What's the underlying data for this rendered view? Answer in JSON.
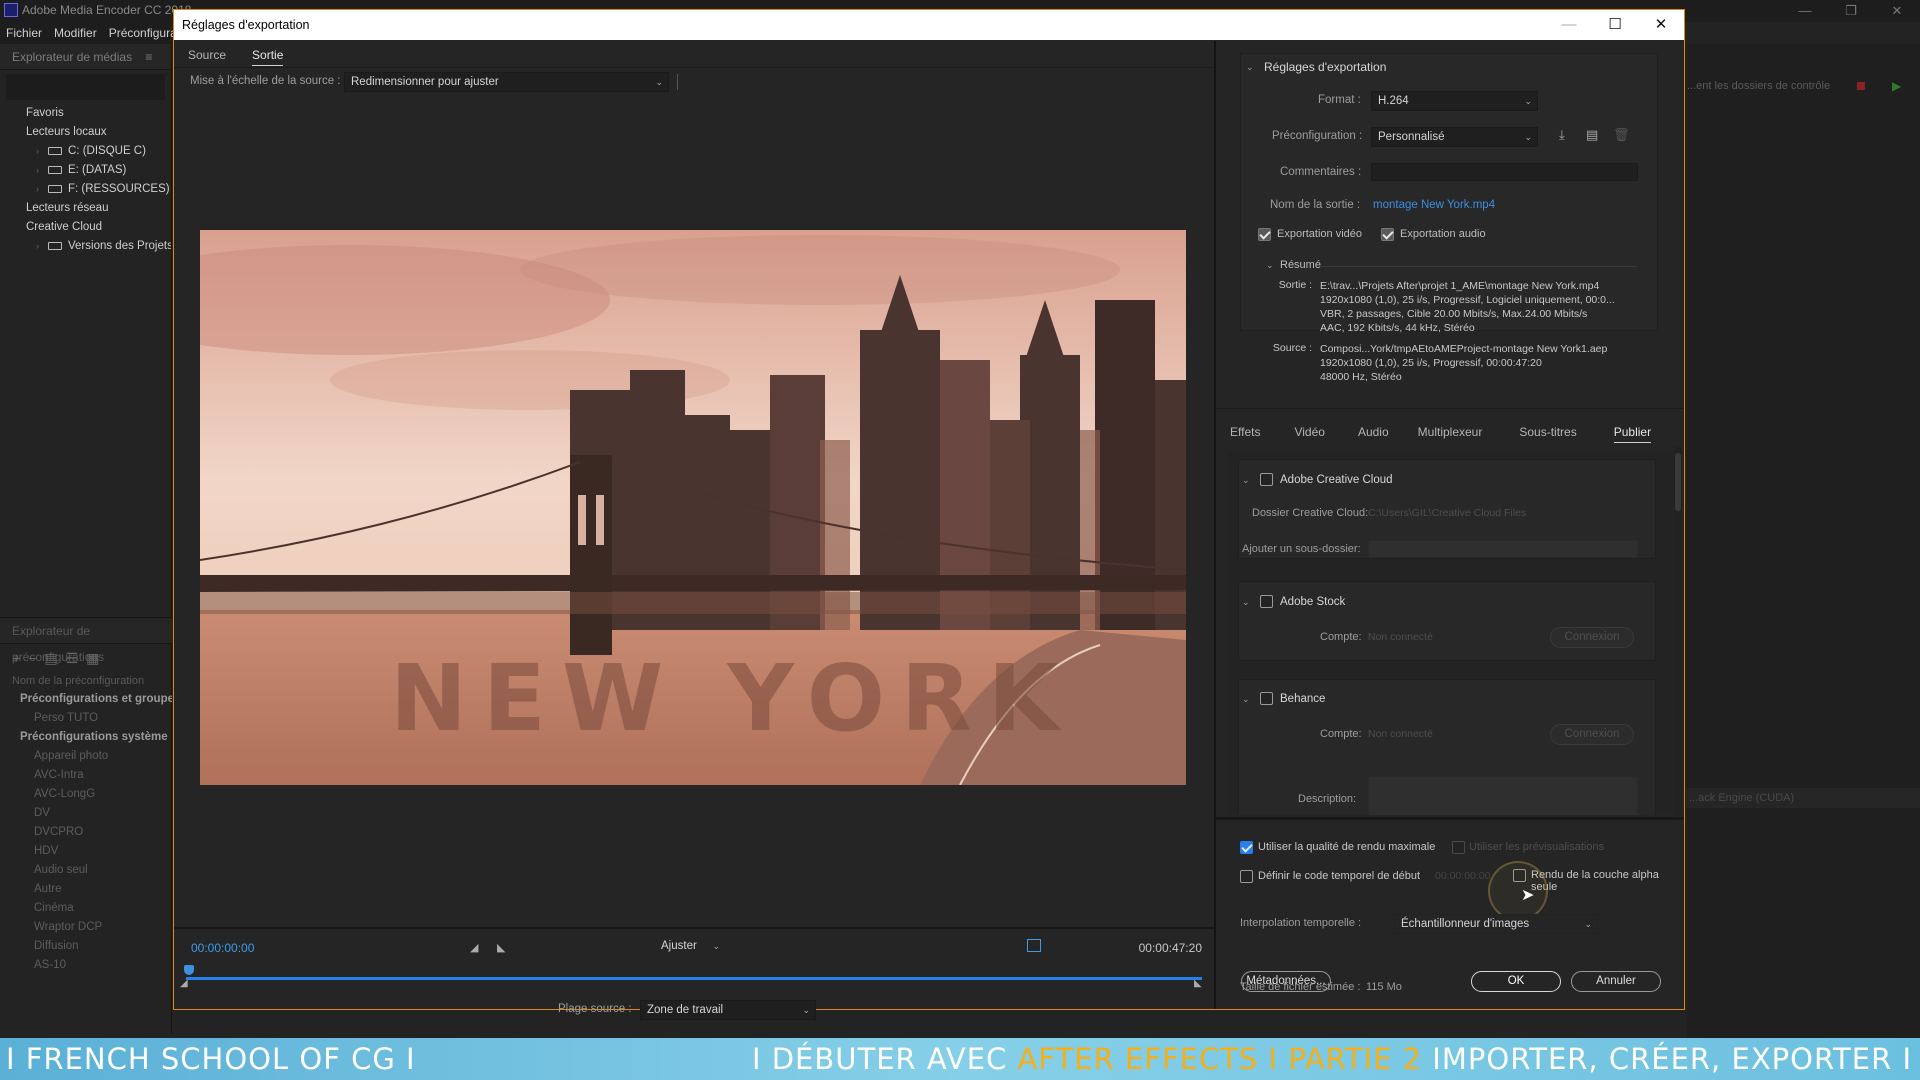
{
  "app": {
    "title": "Adobe Media Encoder CC 2018",
    "menu": [
      "Fichier",
      "Modifier",
      "Préconfiguration"
    ],
    "media_browser_title": "Explorateur de médias",
    "media_tree": [
      {
        "label": "Favoris",
        "indent": 0
      },
      {
        "label": "Lecteurs locaux",
        "indent": 0
      },
      {
        "label": "C: (DISQUE C)",
        "indent": 2
      },
      {
        "label": "E: (DATAS)",
        "indent": 2
      },
      {
        "label": "F: (RESSOURCES)",
        "indent": 2
      },
      {
        "label": "Lecteurs réseau",
        "indent": 0
      },
      {
        "label": "Creative Cloud",
        "indent": 0
      },
      {
        "label": "Versions des Projets",
        "indent": 2
      }
    ],
    "preset_browser_title": "Explorateur de préconfigurations",
    "preset_col": "Nom de la préconfiguration",
    "preset_tree": [
      {
        "label": "Préconfigurations et groupes",
        "kind": "cat"
      },
      {
        "label": "Perso TUTO",
        "kind": "item"
      },
      {
        "label": "Préconfigurations système",
        "kind": "cat"
      },
      {
        "label": "Appareil photo",
        "kind": "item"
      },
      {
        "label": "AVC-Intra",
        "kind": "item"
      },
      {
        "label": "AVC-LongG",
        "kind": "item"
      },
      {
        "label": "DV",
        "kind": "item"
      },
      {
        "label": "DVCPRO",
        "kind": "item"
      },
      {
        "label": "HDV",
        "kind": "item"
      },
      {
        "label": "Audio seul",
        "kind": "item"
      },
      {
        "label": "Autre",
        "kind": "item"
      },
      {
        "label": "Cinéma",
        "kind": "item"
      },
      {
        "label": "Wraptor DCP",
        "kind": "item"
      },
      {
        "label": "Diffusion",
        "kind": "item"
      },
      {
        "label": "AS-10",
        "kind": "item"
      }
    ],
    "right_hint": "...ent les dossiers de contrôle",
    "right_engine": "...ack Engine (CUDA)"
  },
  "dialog": {
    "title": "Réglages d'exportation",
    "left_tabs": [
      "Source",
      "Sortie"
    ],
    "scale_label": "Mise à l'échelle de la source :",
    "scale_value": "Redimensionner pour ajuster",
    "preview_overlay": "NEW YORK",
    "timecode_start": "00:00:00:00",
    "timecode_end": "00:00:47:20",
    "fit_value": "Ajuster",
    "range_label": "Plage source :",
    "range_value": "Zone de travail",
    "export_settings_title": "Réglages d'exportation",
    "format_label": "Format :",
    "format_value": "H.264",
    "preset_label": "Préconfiguration :",
    "preset_value": "Personnalisé",
    "comments_label": "Commentaires :",
    "output_name_label": "Nom de la sortie :",
    "output_name_value": "montage New York.mp4",
    "export_video": "Exportation vidéo",
    "export_audio": "Exportation audio",
    "summary_title": "Résumé",
    "summary_output_label": "Sortie :",
    "summary_output": [
      "E:\\trav...\\Projets After\\projet 1_AME\\montage New York.mp4",
      "1920x1080 (1,0), 25 i/s, Progressif, Logiciel uniquement, 00:0...",
      "VBR, 2 passages, Cible 20.00  Mbits/s, Max.24.00  Mbits/s",
      "AAC, 192  Kbits/s, 44 kHz, Stéréo"
    ],
    "summary_source_label": "Source :",
    "summary_source": [
      "Composi...York/tmpAEtoAMEProject-montage New York1.aep",
      "1920x1080 (1,0), 25 i/s, Progressif, 00:00:47:20",
      "48000 Hz, Stéréo"
    ],
    "right_tabs": [
      "Effets",
      "Vidéo",
      "Audio",
      "Multiplexeur",
      "Sous-titres",
      "Publier"
    ],
    "cc_title": "Adobe Creative Cloud",
    "cc_folder_label": "Dossier Creative Cloud:",
    "cc_folder_value": "C:\\Users\\GIL\\Creative Cloud Files",
    "cc_sub_label": "Ajouter un sous-dossier:",
    "stock_title": "Adobe Stock",
    "account_label": "Compte:",
    "account_value": "Non connecté",
    "connect": "Connexion",
    "behance_title": "Behance",
    "description_label": "Description:",
    "max_quality": "Utiliser la qualité de rendu maximale",
    "use_previews": "Utiliser les prévisualisations",
    "set_timecode": "Définir le code temporel de début",
    "timecode_field": "00:00:00:00",
    "alpha_only": "Rendu de la couche alpha seule",
    "interp_label": "Interpolation temporelle :",
    "interp_value": "Échantillonneur d'images",
    "filesize_label": "Taille de fichier estimée :",
    "filesize_value": "115 Mo",
    "metadata_btn": "Métadonnées...",
    "ok_btn": "OK",
    "cancel_btn": "Annuler"
  },
  "banner": {
    "left": "I FRENCH SCHOOL OF CG I",
    "right_pre": "I DÉBUTER AVEC ",
    "right_hl": "AFTER EFFECTS I PARTIE 2",
    "right_post": " IMPORTER, CRÉER, EXPORTER I"
  },
  "colors": {
    "accent": "#2680eb",
    "link": "#3d8fe0",
    "dialog_border": "#e08a00",
    "banner_highlight": "#f3b01a"
  }
}
